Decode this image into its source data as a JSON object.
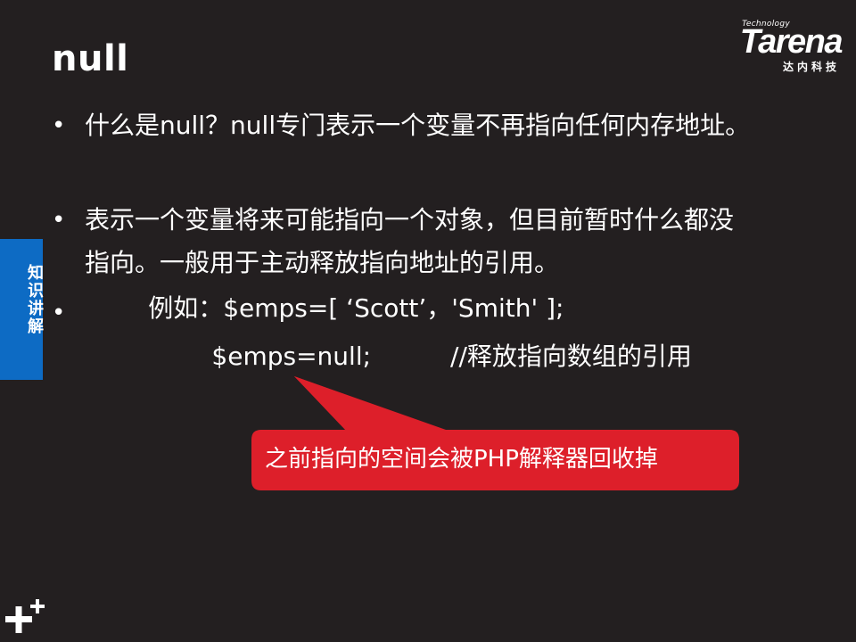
{
  "slide": {
    "title": "null",
    "logo": {
      "tech": "Technology",
      "word": "Tarena",
      "cn": "达内科技"
    },
    "side_tab": "知识讲解",
    "bullets": [
      {
        "dot": "•",
        "lines": [
          "什么是null？null专门表示一个变量不再指向任何内存地址。"
        ]
      },
      {
        "dot": "•",
        "lines": [
          "表示一个变量将来可能指向一个对象，但目前暂时什么都没",
          "指向。一般用于主动释放指向地址的引用。"
        ]
      },
      {
        "dot": "•",
        "lines": [
          "        例如：$emps=[ ‘Scott’，'Smith' ];",
          "                $emps=null;          //释放指向数组的引用"
        ]
      }
    ],
    "callout": "之前指向的空间会被PHP解释器回收掉",
    "colors": {
      "background": "#231f20",
      "callout": "#dd1f2a",
      "tab": "#0d6bc4"
    }
  }
}
